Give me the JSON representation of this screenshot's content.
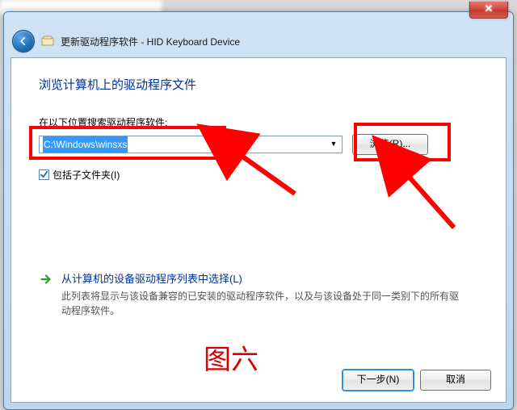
{
  "header": {
    "title": "更新驱动程序软件 - HID Keyboard Device"
  },
  "main": {
    "heading": "浏览计算机上的驱动程序文件",
    "search_label": "在以下位置搜索驱动程序软件:",
    "path_value": "C:\\Windows\\winsxs",
    "browse_label": "浏览(R)...",
    "include_subfolders_label": "包括子文件夹(I)",
    "include_subfolders_checked": true,
    "option": {
      "title": "从计算机的设备驱动程序列表中选择(L)",
      "desc": "此列表将显示与该设备兼容的已安装的驱动程序软件，以及与该设备处于同一类别下的所有驱动程序软件。"
    }
  },
  "footer": {
    "next_label": "下一步(N)",
    "cancel_label": "取消"
  },
  "annotations": {
    "caption": "图六"
  },
  "colors": {
    "accent": "#003399",
    "highlight": "#ff0000"
  }
}
